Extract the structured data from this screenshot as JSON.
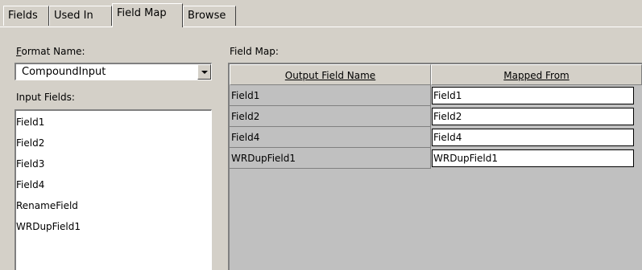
{
  "tabs": [
    {
      "label": "Fields"
    },
    {
      "label": "Used In"
    },
    {
      "label": "Field Map",
      "active": true
    },
    {
      "label": "Browse"
    }
  ],
  "format_name": {
    "label_first": "F",
    "label_rest": "ormat Name:",
    "value": "CompoundInput"
  },
  "input_fields": {
    "label": "Input Fields:",
    "items": [
      "Field1",
      "Field2",
      "Field3",
      "Field4",
      "RenameField",
      "WRDupField1"
    ]
  },
  "field_map": {
    "label": "Field Map:",
    "columns": [
      "Output Field Name",
      "Mapped From"
    ],
    "rows": [
      {
        "output": "Field1",
        "mapped": "Field1"
      },
      {
        "output": "Field2",
        "mapped": "Field2"
      },
      {
        "output": "Field4",
        "mapped": "Field4"
      },
      {
        "output": "WRDupField1",
        "mapped": "WRDupField1"
      }
    ]
  },
  "colors": {
    "face": "#d4d0c8",
    "shadow": "#808080",
    "highlight": "#ffffff",
    "grid_bg": "#c0c0c0"
  }
}
